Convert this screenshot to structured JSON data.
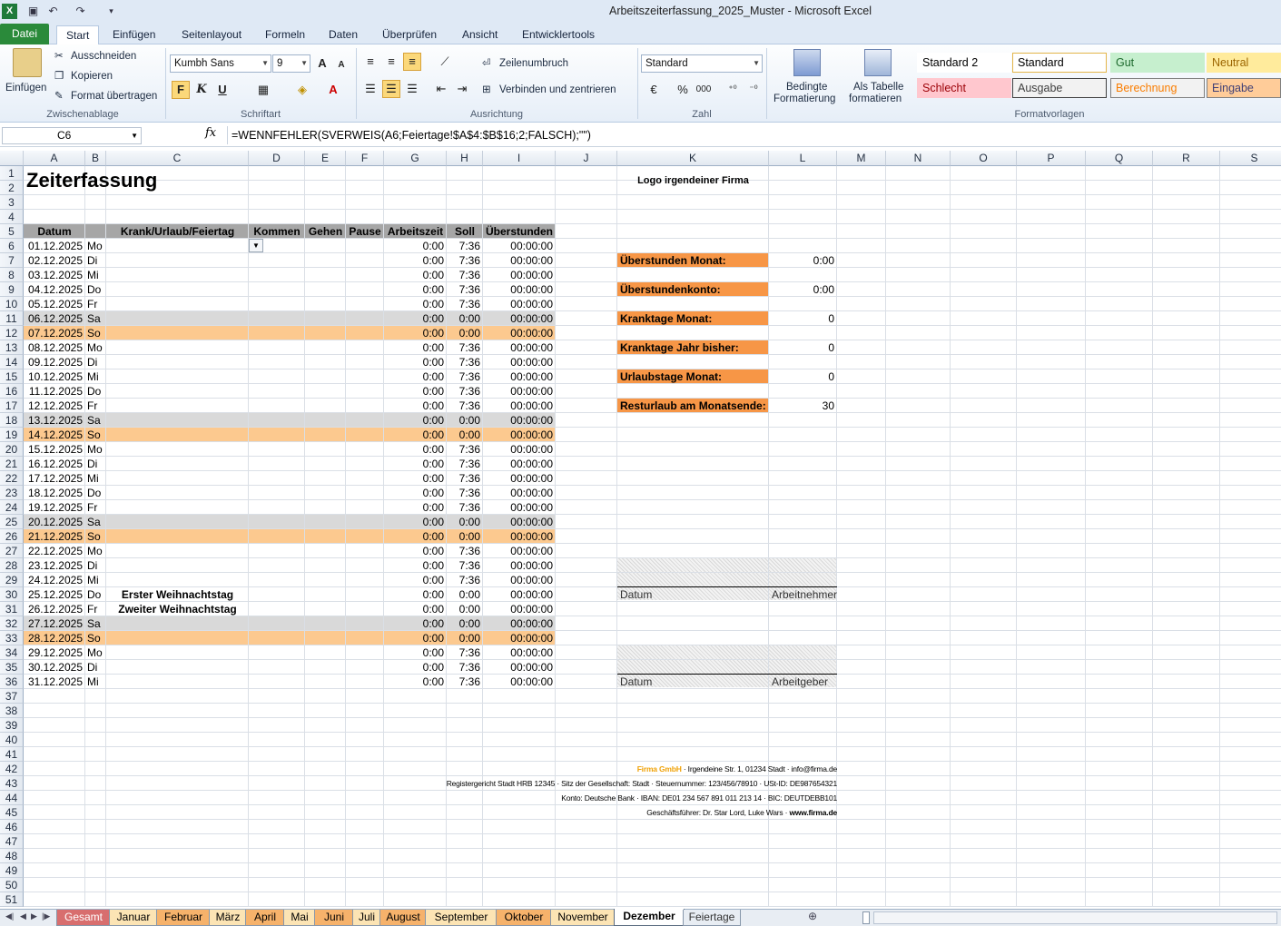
{
  "window": {
    "title": "Arbeitszeiterfassung_2025_Muster  -  Microsoft Excel"
  },
  "ribbon_tabs": [
    "Datei",
    "Start",
    "Einfügen",
    "Seitenlayout",
    "Formeln",
    "Daten",
    "Überprüfen",
    "Ansicht",
    "Entwicklertools"
  ],
  "clipboard": {
    "paste": "Einfügen",
    "cut": "Ausschneiden",
    "copy": "Kopieren",
    "format_painter": "Format übertragen",
    "group": "Zwischenablage"
  },
  "font": {
    "name": "Kumbh Sans",
    "size": "9",
    "bold": "F",
    "italic": "K",
    "underline": "U",
    "group": "Schriftart"
  },
  "alignment": {
    "wrap": "Zeilenumbruch",
    "merge": "Verbinden und zentrieren",
    "group": "Ausrichtung"
  },
  "number": {
    "format": "Standard",
    "percent": "%",
    "thousands": "000",
    "group": "Zahl"
  },
  "styles_group": {
    "cond_format_1": "Bedingte",
    "cond_format_2": "Formatierung",
    "table_1": "Als Tabelle",
    "table_2": "formatieren",
    "group": "Formatvorlagen"
  },
  "styles": [
    {
      "label": "Standard 2",
      "bg": "#ffffff",
      "fg": "#000000",
      "border": "#ffffff"
    },
    {
      "label": "Standard",
      "bg": "#ffffff",
      "fg": "#000000",
      "border": "#e3b54a"
    },
    {
      "label": "Gut",
      "bg": "#c6efce",
      "fg": "#1e6a2e",
      "border": "#c6efce"
    },
    {
      "label": "Neutral",
      "bg": "#ffeb9c",
      "fg": "#9c6500",
      "border": "#ffeb9c"
    },
    {
      "label": "Schlecht",
      "bg": "#ffc7ce",
      "fg": "#9c0006",
      "border": "#ffc7ce"
    },
    {
      "label": "Ausgabe",
      "bg": "#f2f2f2",
      "fg": "#3f3f3f",
      "border": "#3f3f3f"
    },
    {
      "label": "Berechnung",
      "bg": "#f2f2f2",
      "fg": "#fa7d00",
      "border": "#7f7f7f"
    },
    {
      "label": "Eingabe",
      "bg": "#ffcc99",
      "fg": "#3f3f76",
      "border": "#7f7f7f"
    }
  ],
  "formula_bar": {
    "cell_ref": "C6",
    "fx": "fx",
    "formula": "=WENNFEHLER(SVERWEIS(A6;Feiertage!$A$4:$B$16;2;FALSCH);\"\")"
  },
  "columns": [
    "A",
    "B",
    "C",
    "D",
    "E",
    "F",
    "G",
    "H",
    "I",
    "J",
    "K",
    "L",
    "M",
    "N",
    "O",
    "P",
    "Q",
    "R",
    "S"
  ],
  "sheet": {
    "title": "Zeiterfassung",
    "logo": "Logo irgendeiner Firma",
    "headers": [
      "Datum",
      "Krank/Urlaub/Feiertag",
      "Kommen",
      "Gehen",
      "Pause",
      "Arbeitszeit",
      "Soll",
      "Überstunden"
    ],
    "days": [
      {
        "date": "01.12.2025",
        "wd": "Mo",
        "note": "",
        "az": "0:00",
        "soll": "7:36",
        "ue": "00:00:00",
        "type": "normal"
      },
      {
        "date": "02.12.2025",
        "wd": "Di",
        "note": "",
        "az": "0:00",
        "soll": "7:36",
        "ue": "00:00:00",
        "type": "normal"
      },
      {
        "date": "03.12.2025",
        "wd": "Mi",
        "note": "",
        "az": "0:00",
        "soll": "7:36",
        "ue": "00:00:00",
        "type": "normal"
      },
      {
        "date": "04.12.2025",
        "wd": "Do",
        "note": "",
        "az": "0:00",
        "soll": "7:36",
        "ue": "00:00:00",
        "type": "normal"
      },
      {
        "date": "05.12.2025",
        "wd": "Fr",
        "note": "",
        "az": "0:00",
        "soll": "7:36",
        "ue": "00:00:00",
        "type": "normal"
      },
      {
        "date": "06.12.2025",
        "wd": "Sa",
        "note": "",
        "az": "0:00",
        "soll": "0:00",
        "ue": "00:00:00",
        "type": "sat"
      },
      {
        "date": "07.12.2025",
        "wd": "So",
        "note": "",
        "az": "0:00",
        "soll": "0:00",
        "ue": "00:00:00",
        "type": "sun"
      },
      {
        "date": "08.12.2025",
        "wd": "Mo",
        "note": "",
        "az": "0:00",
        "soll": "7:36",
        "ue": "00:00:00",
        "type": "normal"
      },
      {
        "date": "09.12.2025",
        "wd": "Di",
        "note": "",
        "az": "0:00",
        "soll": "7:36",
        "ue": "00:00:00",
        "type": "normal"
      },
      {
        "date": "10.12.2025",
        "wd": "Mi",
        "note": "",
        "az": "0:00",
        "soll": "7:36",
        "ue": "00:00:00",
        "type": "normal"
      },
      {
        "date": "11.12.2025",
        "wd": "Do",
        "note": "",
        "az": "0:00",
        "soll": "7:36",
        "ue": "00:00:00",
        "type": "normal"
      },
      {
        "date": "12.12.2025",
        "wd": "Fr",
        "note": "",
        "az": "0:00",
        "soll": "7:36",
        "ue": "00:00:00",
        "type": "normal"
      },
      {
        "date": "13.12.2025",
        "wd": "Sa",
        "note": "",
        "az": "0:00",
        "soll": "0:00",
        "ue": "00:00:00",
        "type": "sat"
      },
      {
        "date": "14.12.2025",
        "wd": "So",
        "note": "",
        "az": "0:00",
        "soll": "0:00",
        "ue": "00:00:00",
        "type": "sun"
      },
      {
        "date": "15.12.2025",
        "wd": "Mo",
        "note": "",
        "az": "0:00",
        "soll": "7:36",
        "ue": "00:00:00",
        "type": "normal"
      },
      {
        "date": "16.12.2025",
        "wd": "Di",
        "note": "",
        "az": "0:00",
        "soll": "7:36",
        "ue": "00:00:00",
        "type": "normal"
      },
      {
        "date": "17.12.2025",
        "wd": "Mi",
        "note": "",
        "az": "0:00",
        "soll": "7:36",
        "ue": "00:00:00",
        "type": "normal"
      },
      {
        "date": "18.12.2025",
        "wd": "Do",
        "note": "",
        "az": "0:00",
        "soll": "7:36",
        "ue": "00:00:00",
        "type": "normal"
      },
      {
        "date": "19.12.2025",
        "wd": "Fr",
        "note": "",
        "az": "0:00",
        "soll": "7:36",
        "ue": "00:00:00",
        "type": "normal"
      },
      {
        "date": "20.12.2025",
        "wd": "Sa",
        "note": "",
        "az": "0:00",
        "soll": "0:00",
        "ue": "00:00:00",
        "type": "sat"
      },
      {
        "date": "21.12.2025",
        "wd": "So",
        "note": "",
        "az": "0:00",
        "soll": "0:00",
        "ue": "00:00:00",
        "type": "sun"
      },
      {
        "date": "22.12.2025",
        "wd": "Mo",
        "note": "",
        "az": "0:00",
        "soll": "7:36",
        "ue": "00:00:00",
        "type": "normal"
      },
      {
        "date": "23.12.2025",
        "wd": "Di",
        "note": "",
        "az": "0:00",
        "soll": "7:36",
        "ue": "00:00:00",
        "type": "normal"
      },
      {
        "date": "24.12.2025",
        "wd": "Mi",
        "note": "",
        "az": "0:00",
        "soll": "7:36",
        "ue": "00:00:00",
        "type": "normal"
      },
      {
        "date": "25.12.2025",
        "wd": "Do",
        "note": "Erster Weihnachtstag",
        "az": "0:00",
        "soll": "0:00",
        "ue": "00:00:00",
        "type": "normal"
      },
      {
        "date": "26.12.2025",
        "wd": "Fr",
        "note": "Zweiter Weihnachtstag",
        "az": "0:00",
        "soll": "0:00",
        "ue": "00:00:00",
        "type": "normal"
      },
      {
        "date": "27.12.2025",
        "wd": "Sa",
        "note": "",
        "az": "0:00",
        "soll": "0:00",
        "ue": "00:00:00",
        "type": "sat"
      },
      {
        "date": "28.12.2025",
        "wd": "So",
        "note": "",
        "az": "0:00",
        "soll": "0:00",
        "ue": "00:00:00",
        "type": "sun"
      },
      {
        "date": "29.12.2025",
        "wd": "Mo",
        "note": "",
        "az": "0:00",
        "soll": "7:36",
        "ue": "00:00:00",
        "type": "normal"
      },
      {
        "date": "30.12.2025",
        "wd": "Di",
        "note": "",
        "az": "0:00",
        "soll": "7:36",
        "ue": "00:00:00",
        "type": "normal"
      },
      {
        "date": "31.12.2025",
        "wd": "Mi",
        "note": "",
        "az": "0:00",
        "soll": "7:36",
        "ue": "00:00:00",
        "type": "normal"
      }
    ],
    "summary": [
      {
        "label": "Überstunden Monat:",
        "value": "0:00",
        "row": 7
      },
      {
        "label": "Überstundenkonto:",
        "value": "0:00",
        "row": 9
      },
      {
        "label": "Kranktage Monat:",
        "value": "0",
        "row": 11
      },
      {
        "label": "Kranktage Jahr bisher:",
        "value": "0",
        "row": 13
      },
      {
        "label": "Urlaubstage Monat:",
        "value": "0",
        "row": 15
      },
      {
        "label": "Resturlaub am Monatsende:",
        "value": "30",
        "row": 17
      }
    ],
    "signature1": {
      "left": "Datum",
      "right": "Arbeitnehmer"
    },
    "signature2": {
      "left": "Datum",
      "right": "Arbeitgeber"
    },
    "footer": {
      "company": "Firma GmbH",
      "line1_rest": " · Irgendeine Str. 1, 01234 Stadt · info@firma.de",
      "line2": "Registergericht Stadt HRB 12345 · Sitz der Gesellschaft: Stadt · Steuernummer: 123/456/78910 · USt-ID: DE987654321",
      "line3": "Konto: Deutsche Bank · IBAN: DE01 234 567 891 011 213 14 · BIC: DEUTDEBB101",
      "line4_a": "Geschäftsführer: Dr. Star Lord, Luke Wars · ",
      "line4_b": "www.firma.de"
    },
    "colors": {
      "sat": "#d9d9d9",
      "sun": "#fcc98f",
      "header": "#a6a6a6",
      "summary": "#f79646",
      "footer_brand": "#f0a30a"
    }
  },
  "sheet_tabs": [
    {
      "label": "Gesamt",
      "bg": "#d86e6e",
      "fg": "#ffffff",
      "active": false
    },
    {
      "label": "Januar",
      "bg": "#fce4b4",
      "fg": "#000",
      "active": false
    },
    {
      "label": "Februar",
      "bg": "#f6b26b",
      "fg": "#000",
      "active": false
    },
    {
      "label": "März",
      "bg": "#fce4b4",
      "fg": "#000",
      "active": false
    },
    {
      "label": "April",
      "bg": "#f6b26b",
      "fg": "#000",
      "active": false
    },
    {
      "label": "Mai",
      "bg": "#fce4b4",
      "fg": "#000",
      "active": false
    },
    {
      "label": "Juni",
      "bg": "#f6b26b",
      "fg": "#000",
      "active": false
    },
    {
      "label": "Juli",
      "bg": "#fce4b4",
      "fg": "#000",
      "active": false
    },
    {
      "label": "August",
      "bg": "#f6b26b",
      "fg": "#000",
      "active": false
    },
    {
      "label": "September",
      "bg": "#fce4b4",
      "fg": "#000",
      "active": false
    },
    {
      "label": "Oktober",
      "bg": "#f6b26b",
      "fg": "#000",
      "active": false
    },
    {
      "label": "November",
      "bg": "#fce4b4",
      "fg": "#000",
      "active": false
    },
    {
      "label": "Dezember",
      "bg": "#ffffff",
      "fg": "#000",
      "active": true
    },
    {
      "label": "Feiertage",
      "bg": "#e8edf3",
      "fg": "#333",
      "active": false
    }
  ]
}
